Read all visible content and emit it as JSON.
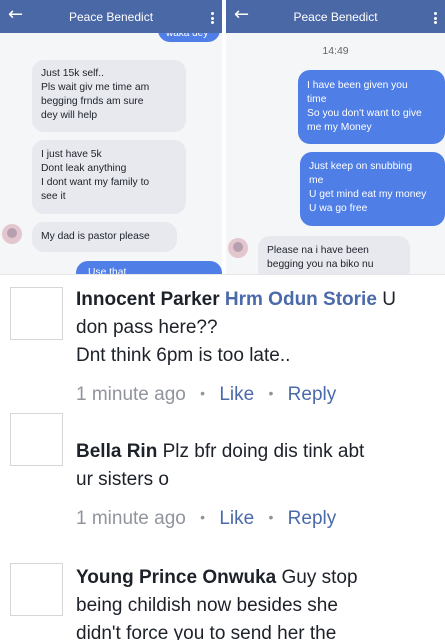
{
  "left_chat": {
    "contact_name": "Peace Benedict",
    "cut_bubble_top": "waka dey",
    "messages": [
      {
        "lines": [
          "Just 15k self..",
          "Pls wait giv me time am",
          "begging frnds am sure",
          "dey will help"
        ]
      },
      {
        "lines": [
          "I just have 5k",
          "Dont leak anything",
          "I dont want my family to",
          "see it"
        ]
      },
      {
        "lines": [
          "My dad is pastor please"
        ]
      }
    ],
    "cut_bubble_bottom": "Use that ..."
  },
  "right_chat": {
    "contact_name": "Peace Benedict",
    "timestamp": "14:49",
    "outgoing": [
      {
        "lines": [
          "I have been given you",
          "time",
          "So you don't want to give",
          "me my Money"
        ]
      },
      {
        "lines": [
          "Just keep on snubbing",
          "me",
          "U get mind eat my money",
          "U wa go free"
        ]
      }
    ],
    "incoming_cut": {
      "lines": [
        "Please na i have been",
        "begging you na biko nu"
      ]
    }
  },
  "comments": [
    {
      "author": "Innocent Parker",
      "mention": "Hrm Odun Storie",
      "text_first": "U",
      "text_rest": [
        "don pass here??",
        "Dnt think 6pm is too late.."
      ],
      "time": "1 minute ago",
      "like": "Like",
      "reply": "Reply"
    },
    {
      "author": "Bella Rin",
      "text_first": "Plz bfr doing dis tink abt",
      "text_rest": [
        "ur sisters o"
      ],
      "time": "1 minute ago",
      "like": "Like",
      "reply": "Reply"
    },
    {
      "author": "Young Prince Onwuka",
      "text_first": "Guy stop",
      "text_rest": [
        "being childish now besides she",
        "didn't force you to send her the"
      ]
    }
  ],
  "icons": {
    "back": "back-arrow-icon",
    "more": "more-vertical-icon",
    "avatar": "avatar"
  },
  "colors": {
    "header": "#4a67a6",
    "outgoing_bubble": "#4e7ee6",
    "incoming_bubble": "#e7e9ef",
    "link": "#4b6aa9",
    "meta": "#90949c"
  }
}
